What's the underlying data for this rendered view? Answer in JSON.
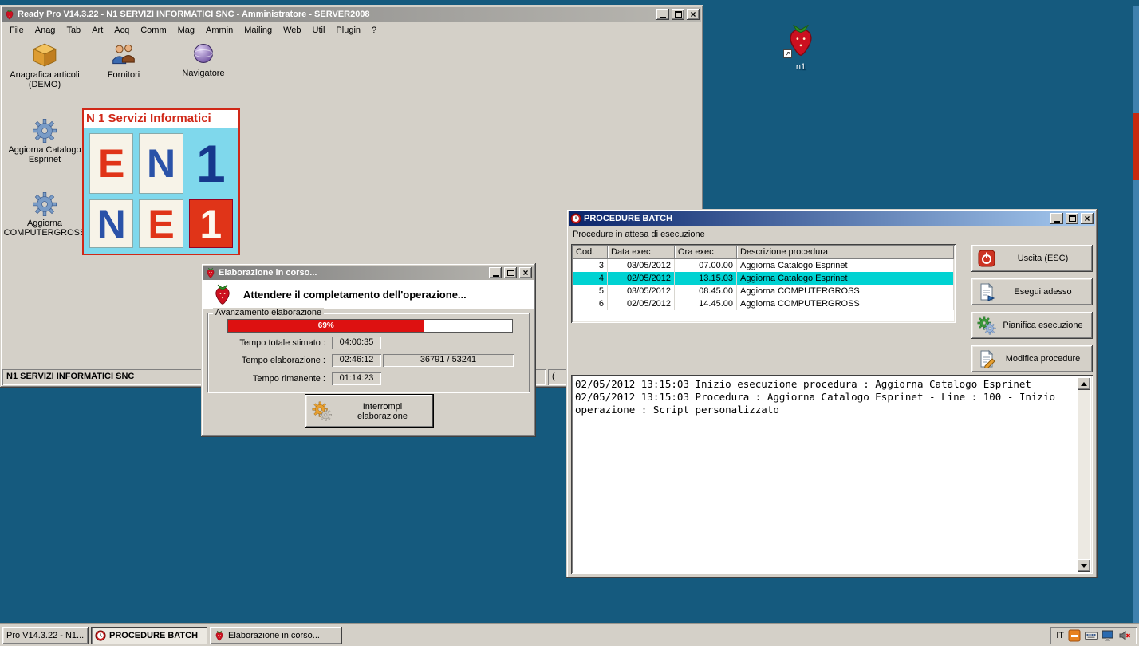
{
  "desktop": {
    "shortcut_label": "n1"
  },
  "main_window": {
    "title": "Ready Pro V14.3.22 - N1 SERVIZI INFORMATICI SNC - Amministratore - SERVER2008",
    "menu": [
      "File",
      "Anag",
      "Tab",
      "Art",
      "Acq",
      "Comm",
      "Mag",
      "Ammin",
      "Mailing",
      "Web",
      "Util",
      "Plugin",
      "?"
    ],
    "shortcuts": {
      "anagrafica": "Anagrafica articoli (DEMO)",
      "fornitori": "Fornitori",
      "navigatore": "Navigatore",
      "esprinet": "Aggiorna Catalogo Esprinet",
      "computergross": "Aggiorna COMPUTERGROSS"
    },
    "logo": {
      "header": "N 1 Servizi Informatici",
      "tiles": [
        "E",
        "N",
        "1",
        "N",
        "E",
        "1"
      ]
    },
    "status_left": "N1 SERVIZI INFORMATICI SNC",
    "status_right": "("
  },
  "progress_dialog": {
    "title": "Elaborazione in corso...",
    "message": "Attendere il completamento dell'operazione...",
    "group_label": "Avanzamento elaborazione",
    "progress": {
      "percent_label": "69%",
      "value": 69
    },
    "rows": [
      {
        "label": "Tempo totale stimato :",
        "value": "04:00:35"
      },
      {
        "label": "Tempo elaborazione :",
        "value": "02:46:12"
      },
      {
        "label": "Tempo rimanente :",
        "value": "01:14:23"
      }
    ],
    "counter": "36791 / 53241",
    "stop_button": "Interrompi elaborazione"
  },
  "batch_window": {
    "title": "PROCEDURE BATCH",
    "subtitle": "Procedure in attesa di esecuzione",
    "table": {
      "columns": [
        "Cod.",
        "Data exec",
        "Ora exec",
        "Descrizione procedura"
      ],
      "rows": [
        [
          "3",
          "03/05/2012",
          "07.00.00",
          "Aggiorna Catalogo Esprinet"
        ],
        [
          "4",
          "02/05/2012",
          "13.15.03",
          "Aggiorna Catalogo Esprinet"
        ],
        [
          "5",
          "03/05/2012",
          "08.45.00",
          "Aggiorna COMPUTERGROSS"
        ],
        [
          "6",
          "02/05/2012",
          "14.45.00",
          "Aggiorna COMPUTERGROSS"
        ]
      ],
      "selected_row_index": 1
    },
    "buttons": {
      "uscita": "Uscita (ESC)",
      "esegui": "Esegui adesso",
      "pianifica": "Pianifica esecuzione",
      "modifica": "Modifica procedure"
    },
    "log_lines": [
      "02/05/2012 13:15:03 Inizio esecuzione procedura : Aggiorna Catalogo Esprinet",
      "02/05/2012 13:15:03 Procedura : Aggiorna Catalogo Esprinet - Line : 100 - Inizio",
      "operazione : Script personalizzato"
    ]
  },
  "taskbar": {
    "buttons": [
      {
        "label": "Pro V14.3.22 - N1..."
      },
      {
        "label": "PROCEDURE BATCH"
      },
      {
        "label": "Elaborazione in corso..."
      }
    ],
    "tray_language": "IT"
  },
  "colors": {
    "desktop": "#155a7e",
    "selection": "#00d2d2",
    "progress_fill": "#dd1111",
    "titlebar_active_start": "#0a246a",
    "titlebar_active_end": "#a6caf0"
  }
}
